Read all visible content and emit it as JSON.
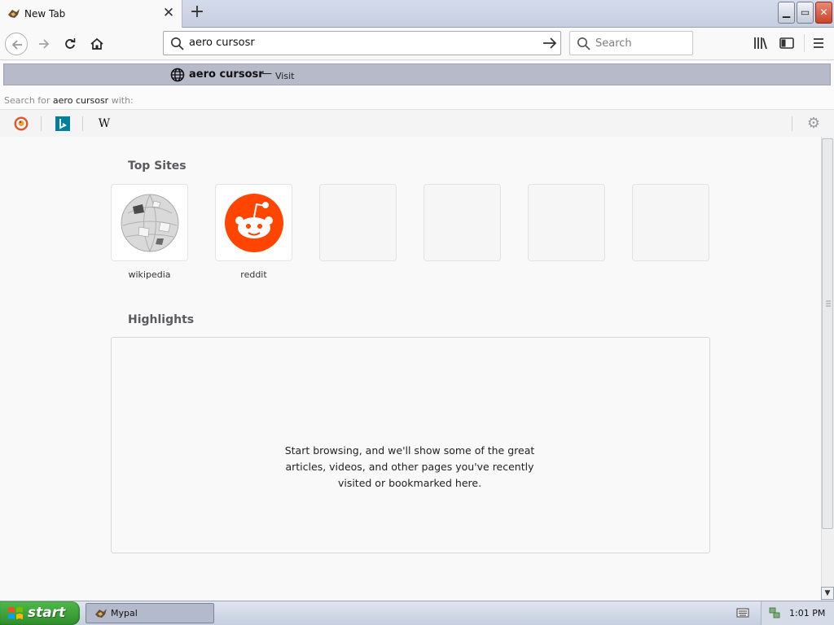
{
  "tab": {
    "title": "New Tab",
    "close_glyph": "✕",
    "new_glyph": "+"
  },
  "window_controls": {
    "minimize": "▁",
    "maximize": "▭",
    "close": "✕"
  },
  "navbar": {
    "url_value": "aero cursosr",
    "search_placeholder": "Search",
    "icons": [
      "back-icon",
      "forward-icon",
      "reload-icon",
      "home-icon",
      "library-icon",
      "sidebar-icon",
      "hamburger-menu-icon"
    ]
  },
  "dropdown": {
    "suggestion": {
      "text": "aero cursosr",
      "dash": "—",
      "action": "Visit"
    },
    "search_with": {
      "prefix": "Search for ",
      "query": "aero cursosr",
      "suffix": " with:"
    },
    "engines": [
      {
        "name": "DuckDuckGo",
        "icon": "duckduckgo-icon"
      },
      {
        "name": "Bing",
        "icon": "bing-icon",
        "glyph": "b"
      },
      {
        "name": "Wikipedia",
        "icon": "wikipedia-icon",
        "glyph": "W"
      }
    ],
    "settings_glyph": "⚙"
  },
  "content": {
    "top_sites_title": "Top Sites",
    "top_sites": [
      {
        "label": "wikipedia"
      },
      {
        "label": "reddit"
      }
    ],
    "highlights_title": "Highlights",
    "highlights_message": "Start browsing, and we'll show some of the great articles, videos, and other pages you've recently visited or bookmarked here."
  },
  "scrollbar": {
    "down_glyph": "▼"
  },
  "taskbar": {
    "start_label": "start",
    "task": "Mypal",
    "clock": "1:01 PM"
  },
  "colors": {
    "reddit": "#ff4500",
    "start_green": "#3a9a35",
    "suggest_row": "#b7bac8"
  }
}
